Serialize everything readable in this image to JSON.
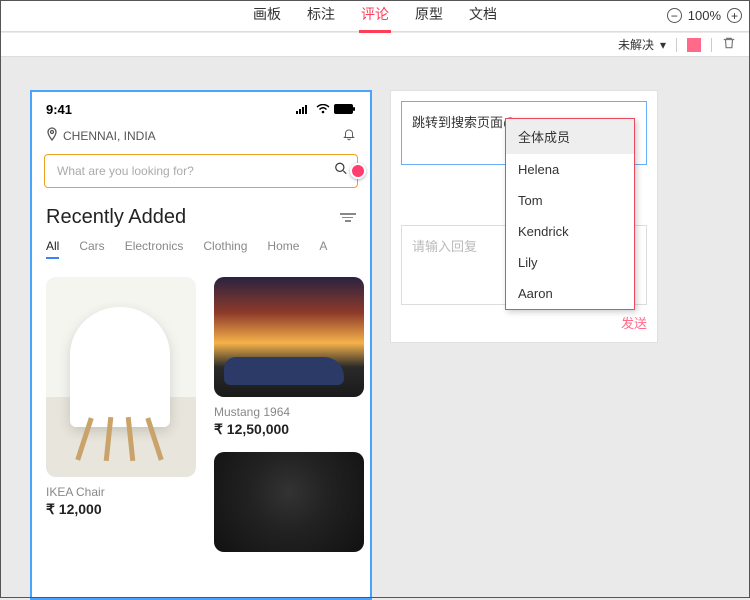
{
  "topbar": {
    "tabs": [
      "画板",
      "标注",
      "评论",
      "原型",
      "文档"
    ],
    "active_index": 2,
    "zoom": "100%"
  },
  "secbar": {
    "filter_label": "未解决"
  },
  "artboard": {
    "status": {
      "time": "9:41"
    },
    "location": "CHENNAI, INDIA",
    "search_placeholder": "What are you looking for?",
    "section_title": "Recently Added",
    "categories": [
      "All",
      "Cars",
      "Electronics",
      "Clothing",
      "Home",
      "A"
    ],
    "active_category_index": 0,
    "cards": [
      {
        "title": "IKEA Chair",
        "price": "₹ 12,000"
      },
      {
        "title": "Mustang 1964",
        "price": "₹ 12,50,000"
      }
    ]
  },
  "comment_panel": {
    "comment_text": "跳转到搜索页面@",
    "reply_placeholder": "请输入回复",
    "send_label": "发送"
  },
  "mention_dropdown": {
    "items": [
      "全体成员",
      "Helena",
      "Tom",
      "Kendrick",
      "Lily",
      "Aaron"
    ],
    "highlighted_index": 0
  }
}
